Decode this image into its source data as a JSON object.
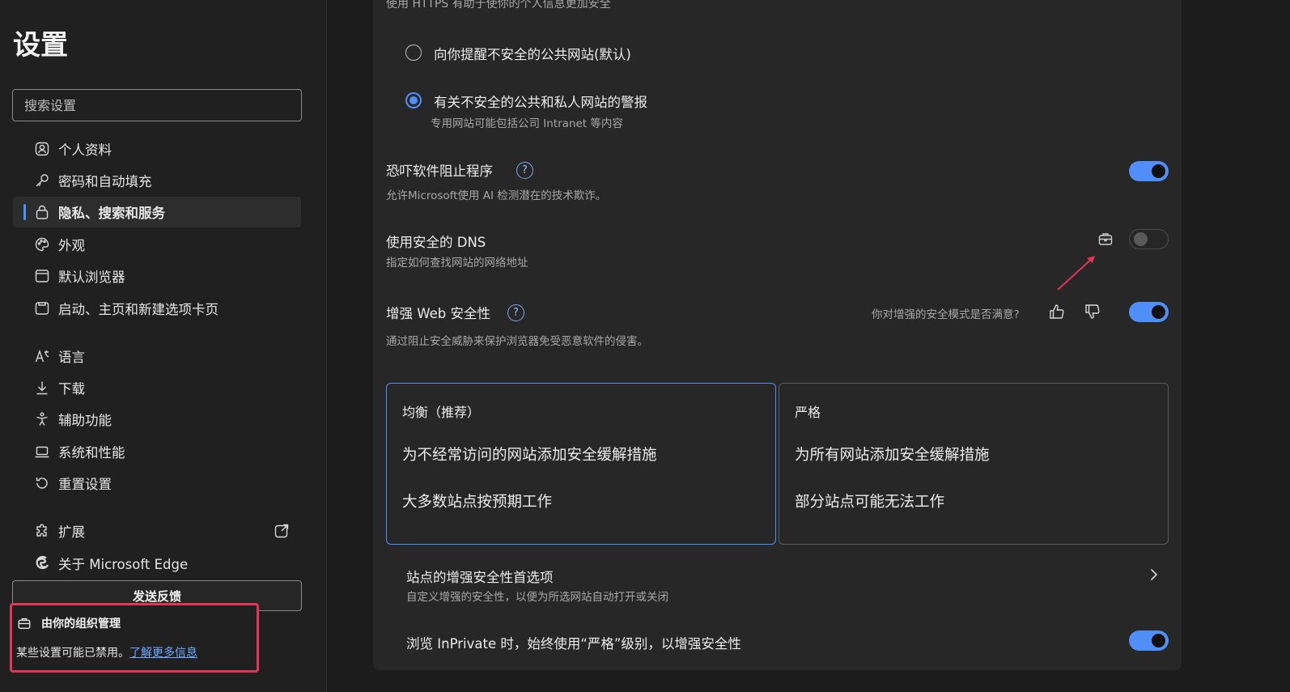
{
  "sidebar": {
    "title": "设置",
    "search_placeholder": "搜索设置",
    "items": [
      {
        "label": "个人资料",
        "icon": "profile-icon"
      },
      {
        "label": "密码和自动填充",
        "icon": "key-icon"
      },
      {
        "label": "隐私、搜索和服务",
        "icon": "lock-icon",
        "active": true
      },
      {
        "label": "外观",
        "icon": "palette-icon"
      },
      {
        "label": "默认浏览器",
        "icon": "browser-icon"
      },
      {
        "label": "启动、主页和新建选项卡页",
        "icon": "home-icon"
      },
      {
        "label": "语言",
        "icon": "language-icon"
      },
      {
        "label": "下载",
        "icon": "download-icon"
      },
      {
        "label": "辅助功能",
        "icon": "accessibility-icon"
      },
      {
        "label": "系统和性能",
        "icon": "laptop-icon"
      },
      {
        "label": "重置设置",
        "icon": "reset-icon"
      },
      {
        "label": "扩展",
        "icon": "puzzle-icon"
      },
      {
        "label": "关于 Microsoft Edge",
        "icon": "edge-icon"
      }
    ],
    "feedback_label": "发送反馈",
    "managed": {
      "title": "由你的组织管理",
      "text": "某些设置可能已禁用。",
      "link": "了解更多信息"
    }
  },
  "main": {
    "https_desc": "使用 HTTPS 有助于使你的个人信息更加安全",
    "radio1_label": "向你提醒不安全的公共网站(默认)",
    "radio2_label": "有关不安全的公共和私人网站的警报",
    "radio2_desc": "专用网站可能包括公司 Intranet 等内容",
    "scareware_label": "恐吓软件阻止程序",
    "scareware_desc": "允许Microsoft使用 AI 检测潜在的技术欺诈。",
    "dns_label": "使用安全的 DNS",
    "dns_desc": "指定如何查找网站的网络地址",
    "enhanced_label": "增强 Web 安全性",
    "enhanced_desc": "通过阻止安全威胁来保护浏览器免受恶意软件的侵害。",
    "feedback_question": "你对增强的安全模式是否满意?",
    "help_glyph": "?",
    "balanced": {
      "title": "均衡（推荐）",
      "line1": "为不经常访问的网站添加安全缓解措施",
      "line2": "大多数站点按预期工作"
    },
    "strict": {
      "title": "严格",
      "line1": "为所有网站添加安全缓解措施",
      "line2": "部分站点可能无法工作"
    },
    "site_pref_label": "站点的增强安全性首选项",
    "site_pref_desc": "自定义增强的安全性，以便为所选网站自动打开或关闭",
    "inprivate_label": "浏览 InPrivate 时，始终使用“严格”级别，以增强安全性"
  },
  "states": {
    "scareware_on": true,
    "dns_on": false,
    "enhanced_on": true,
    "inprivate_on": true,
    "selected_radio": 2,
    "selected_level": "balanced"
  },
  "colors": {
    "accent": "#4f8ff7",
    "highlight_box": "#e5345a",
    "annotation_arrow": "#e5345a"
  }
}
